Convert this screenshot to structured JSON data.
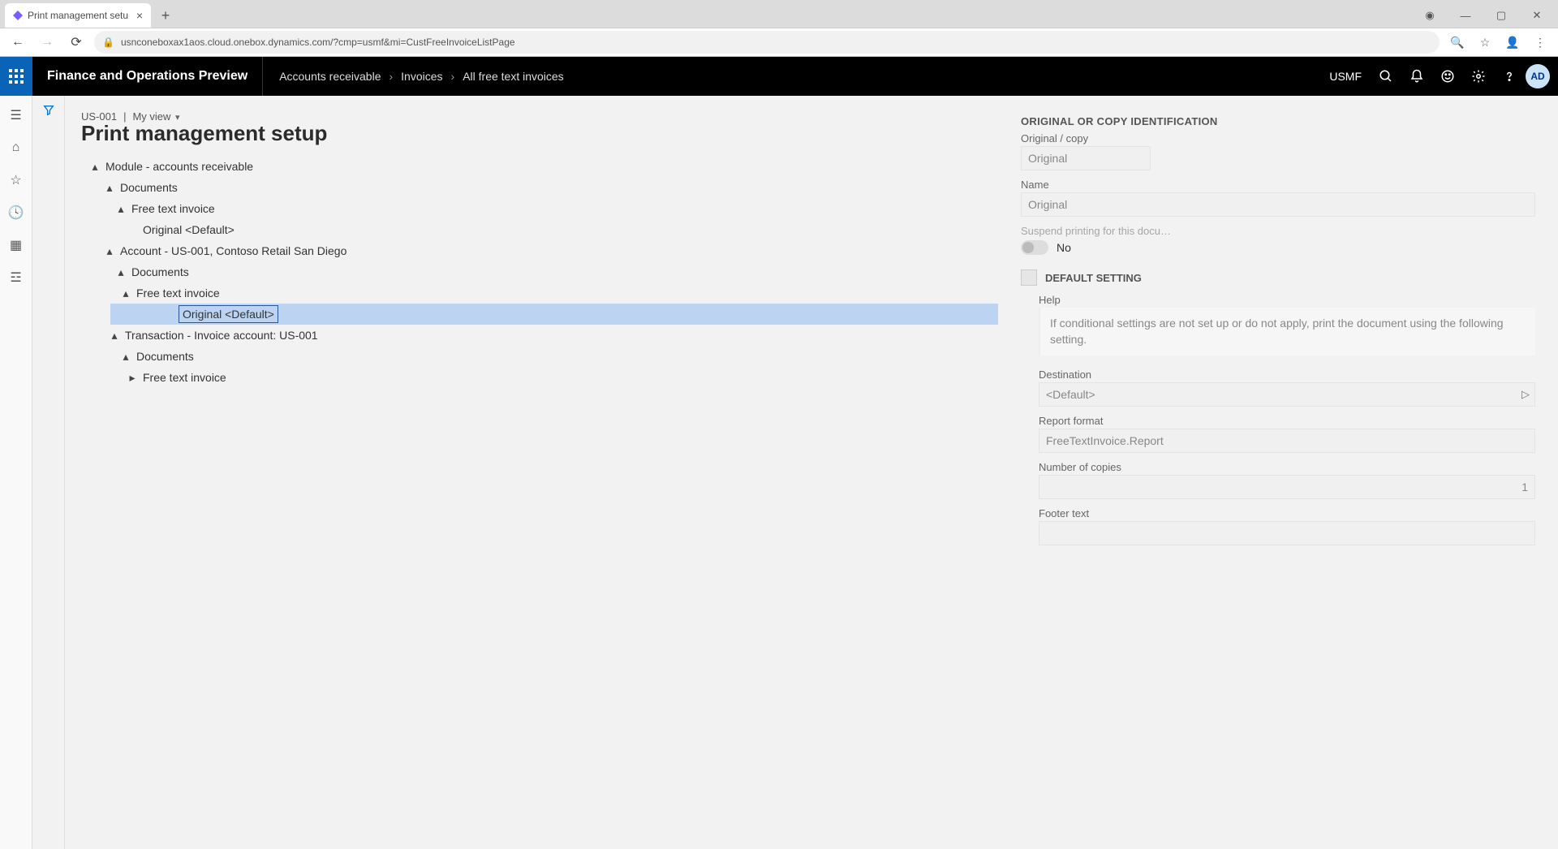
{
  "browser": {
    "tab_title": "Print management setu",
    "url": "usnconeboxax1aos.cloud.onebox.dynamics.com/?cmp=usmf&mi=CustFreeInvoiceListPage"
  },
  "header": {
    "app_title": "Finance and Operations Preview",
    "breadcrumb": [
      "Accounts receivable",
      "Invoices",
      "All free text invoices"
    ],
    "company": "USMF",
    "avatar": "AD"
  },
  "page": {
    "entity": "US-001",
    "view_label": "My view",
    "title": "Print management setup"
  },
  "tree": [
    {
      "indent": 0,
      "expand": "▴",
      "label": "Module - accounts receivable"
    },
    {
      "indent": 1,
      "expand": "▴",
      "label": "Documents"
    },
    {
      "indent": 2,
      "expand": "▴",
      "label": "Free text invoice"
    },
    {
      "indent": 3,
      "expand": "",
      "label": "Original <Default>"
    },
    {
      "indent": 1,
      "expand": "▴",
      "label": "Account - US-001, Contoso Retail San Diego"
    },
    {
      "indent": 2,
      "expand": "▴",
      "label": "Documents"
    },
    {
      "indent": 2,
      "expand": "▴",
      "label": "Free text invoice",
      "extra_indent": true
    },
    {
      "indent": 3,
      "expand": "",
      "label": "Original <Default>",
      "selected": true,
      "extra_indent": true
    },
    {
      "indent": 1,
      "expand": "▴",
      "label": "Transaction - Invoice account: US-001",
      "shift": true
    },
    {
      "indent": 2,
      "expand": "▴",
      "label": "Documents",
      "shift": true
    },
    {
      "indent": 2,
      "expand": "▸",
      "label": "Free text invoice",
      "shift2": true
    }
  ],
  "detail": {
    "section_title": "ORIGINAL OR COPY IDENTIFICATION",
    "original_copy_label": "Original / copy",
    "original_copy_value": "Original",
    "name_label": "Name",
    "name_value": "Original",
    "suspend_label": "Suspend printing for this docu…",
    "suspend_value": "No",
    "default_setting_label": "DEFAULT SETTING",
    "help_label": "Help",
    "help_text": "If conditional settings are not set up or do not apply, print the document using the following setting.",
    "destination_label": "Destination",
    "destination_value": "<Default>",
    "report_format_label": "Report format",
    "report_format_value": "FreeTextInvoice.Report",
    "copies_label": "Number of copies",
    "copies_value": "1",
    "footer_label": "Footer text",
    "footer_value": ""
  }
}
